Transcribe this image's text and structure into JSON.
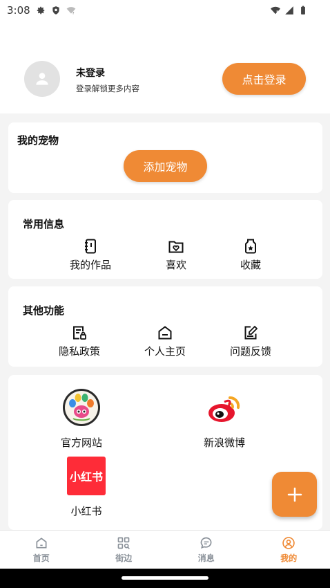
{
  "status_bar": {
    "time": "3:08",
    "icons": [
      "gear-icon",
      "shield-icon",
      "wifi-question-icon",
      "wifi-icon",
      "signal-icon",
      "battery-icon"
    ]
  },
  "profile": {
    "name": "未登录",
    "subtitle": "登录解锁更多内容",
    "login_button": "点击登录"
  },
  "pets": {
    "title": "我的宠物",
    "add_button": "添加宠物"
  },
  "common_info": {
    "title": "常用信息",
    "items": [
      {
        "label": "我的作品",
        "icon": "notebook-icon"
      },
      {
        "label": "喜欢",
        "icon": "heart-folder-icon"
      },
      {
        "label": "收藏",
        "icon": "star-jar-icon"
      }
    ]
  },
  "other_functions": {
    "title": "其他功能",
    "items": [
      {
        "label": "隐私政策",
        "icon": "privacy-doc-icon"
      },
      {
        "label": "个人主页",
        "icon": "home-page-icon"
      },
      {
        "label": "问题反馈",
        "icon": "feedback-edit-icon"
      }
    ]
  },
  "links": {
    "items": [
      {
        "label": "官方网站",
        "icon": "paw-logo-icon"
      },
      {
        "label": "新浪微博",
        "icon": "weibo-logo-icon"
      },
      {
        "label": "小红书",
        "icon": "xiaohongshu-logo-icon",
        "logo_text": "小红书"
      }
    ]
  },
  "fab": {
    "icon": "plus-icon"
  },
  "tab_bar": {
    "tabs": [
      {
        "label": "首页",
        "icon": "home-icon",
        "active": false
      },
      {
        "label": "街边",
        "icon": "grid-search-icon",
        "active": false
      },
      {
        "label": "消息",
        "icon": "chat-icon",
        "active": false
      },
      {
        "label": "我的",
        "icon": "user-icon",
        "active": true
      }
    ]
  },
  "colors": {
    "accent": "#ef8a35",
    "tab_inactive": "#8a9199",
    "weibo_red": "#e6162d",
    "xhs_red": "#fe2c38"
  }
}
